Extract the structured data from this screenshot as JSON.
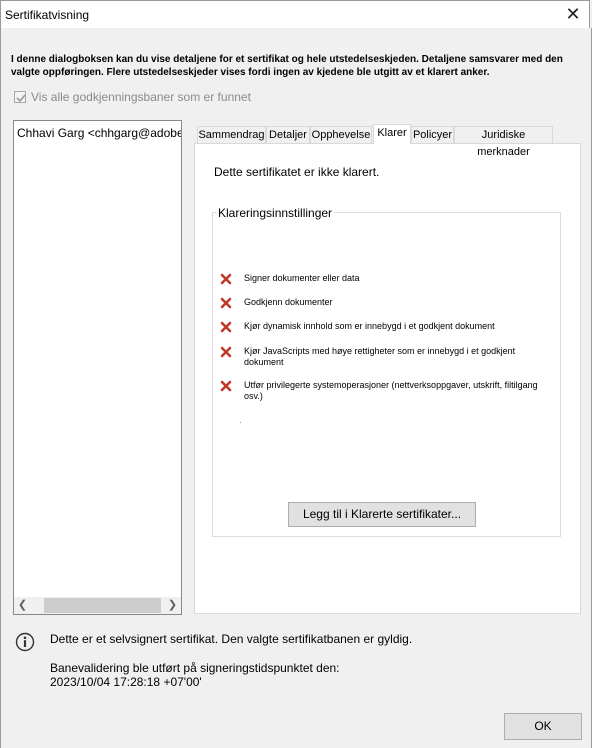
{
  "window": {
    "title": "Sertifikatvisning"
  },
  "intro_text": "I denne dialogboksen kan du vise detaljene for et sertifikat og hele utstedelseskjeden. Detaljene samsvarer med den valgte oppføringen. Flere utstedelseskjeder vises fordi ingen av kjedene ble utgitt av et klarert anker.",
  "show_all_paths": {
    "label": "Vis alle godkjenningsbaner som er funnet",
    "checked": true
  },
  "cert_tree": {
    "items": [
      "Chhavi Garg <chhgarg@adobe.com>"
    ]
  },
  "tabs": [
    "Sammendrag",
    "Detaljer",
    "Opphevelse",
    "Klarer",
    "Policyer",
    "Juridiske merknader"
  ],
  "active_tab": "Klarer",
  "trust": {
    "status_text": "Dette sertifikatet er ikke klarert.",
    "group_title": "Klareringsinnstillinger",
    "permissions": [
      "Signer dokumenter eller data",
      "Godkjenn dokumenter",
      "Kjør dynamisk innhold som er innebygd i et godkjent dokument",
      "Kjør JavaScripts med høye rettigheter som er innebygd i et godkjent dokument",
      "Utfør privilegerte systemoperasjoner (nettverksoppgaver, utskrift, filtilgang osv.)"
    ],
    "add_button": "Legg til i Klarerte sertifikater..."
  },
  "info": {
    "selfsigned": "Dette er et selvsignert sertifikat. Den valgte sertifikatbanen er gyldig.",
    "validation_label": "Banevalidering ble utført på signeringstidspunktet den:",
    "validation_time": "2023/10/04 17:28:18 +07'00'"
  },
  "ok_button": "OK",
  "colors": {
    "deny_icon": "#c0392b",
    "info_icon": "#333333"
  }
}
